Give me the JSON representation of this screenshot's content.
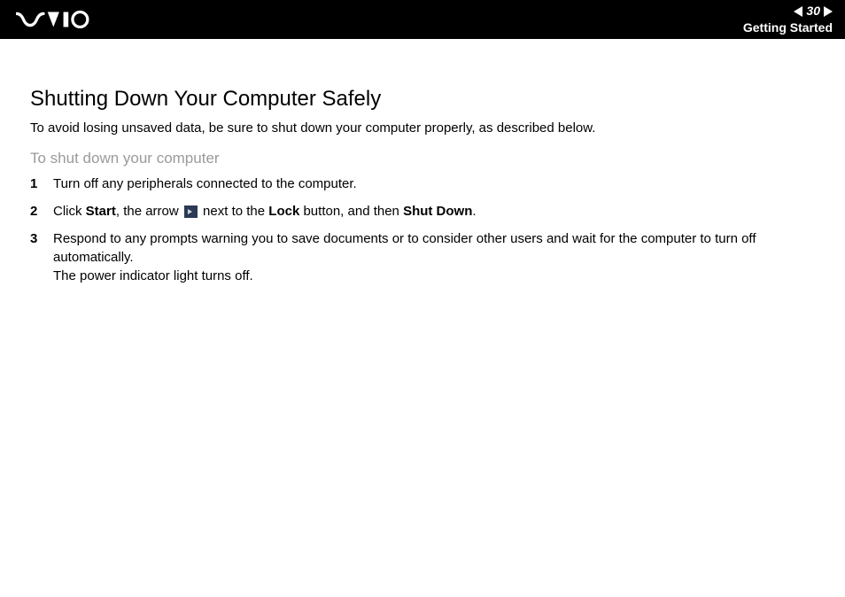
{
  "header": {
    "page_number": "30",
    "breadcrumb": "Getting Started"
  },
  "page": {
    "title": "Shutting Down Your Computer Safely",
    "intro": "To avoid losing unsaved data, be sure to shut down your computer properly, as described below.",
    "sub_title": "To shut down your computer"
  },
  "steps": [
    {
      "num": "1",
      "text": "Turn off any peripherals connected to the computer."
    },
    {
      "num": "2",
      "click": "Click ",
      "start": "Start",
      "the_arrow": ", the arrow ",
      "next_to": " next to the ",
      "lock": "Lock",
      "and_then": " button, and then ",
      "shutdown": "Shut Down",
      "tail": "."
    },
    {
      "num": "3",
      "line1": "Respond to any prompts warning you to save documents or to consider other users and wait for the computer to turn off automatically.",
      "line2": "The power indicator light turns off."
    }
  ]
}
